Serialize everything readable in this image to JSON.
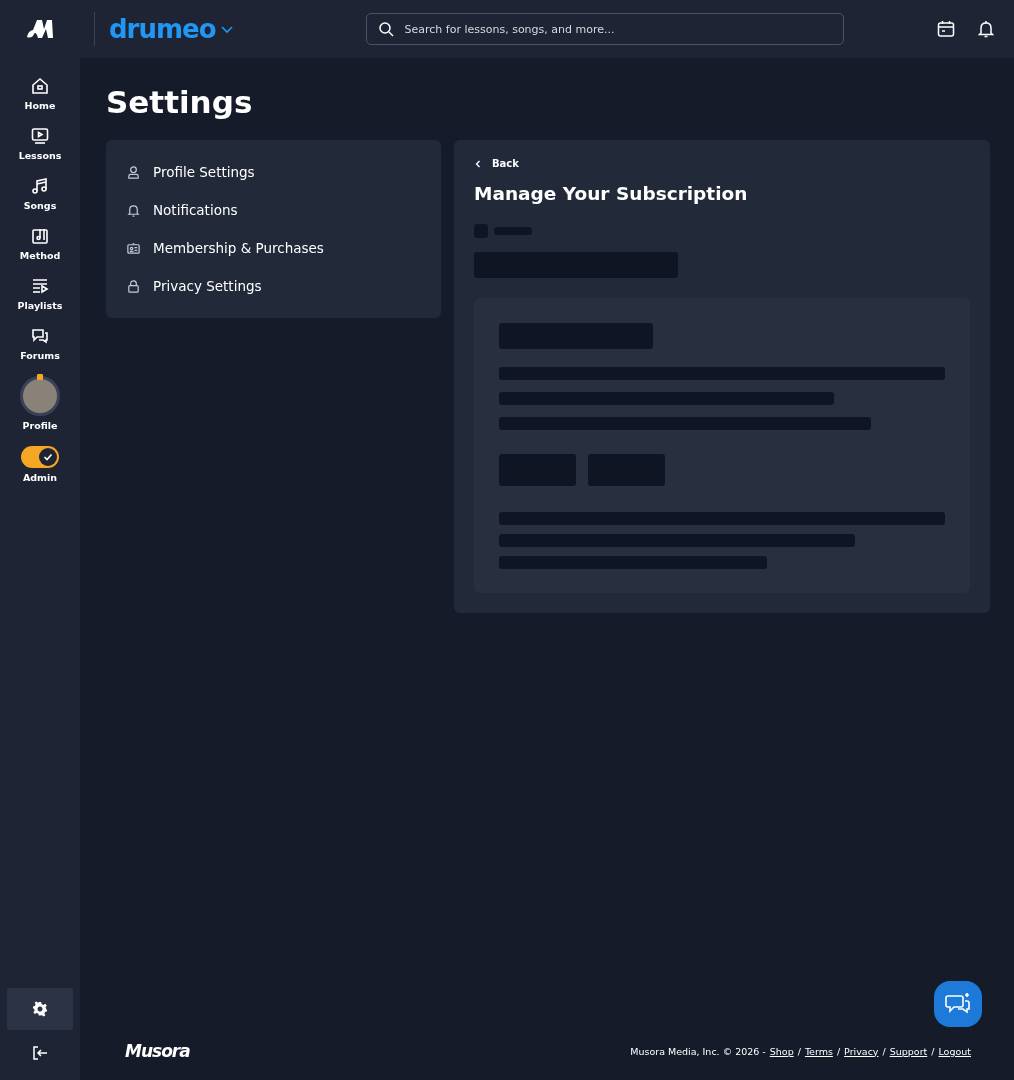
{
  "topbar": {
    "brand": "drumeo",
    "search": {
      "placeholder": "Search for lessons, songs, and more..."
    }
  },
  "sidebar": {
    "items": [
      {
        "kind": "home",
        "label": "Home"
      },
      {
        "kind": "lessons",
        "label": "Lessons"
      },
      {
        "kind": "songs",
        "label": "Songs"
      },
      {
        "kind": "method",
        "label": "Method"
      },
      {
        "kind": "playlists",
        "label": "Playlists"
      },
      {
        "kind": "forums",
        "label": "Forums"
      },
      {
        "kind": "profile",
        "label": "Profile"
      },
      {
        "kind": "toggle",
        "label": "Admin",
        "on": true
      }
    ],
    "settings_selected": true
  },
  "page": {
    "title": "Settings"
  },
  "settings_menu": [
    {
      "kind": "person",
      "label": "Profile Settings"
    },
    {
      "kind": "bell",
      "label": "Notifications"
    },
    {
      "kind": "card",
      "label": "Membership & Purchases"
    },
    {
      "kind": "lock",
      "label": "Privacy Settings"
    }
  ],
  "panel": {
    "back": "Back",
    "title": "Manage Your Subscription"
  },
  "footer": {
    "wordmark": "Musora",
    "copyright": "Musora Media, Inc. © 2026 -",
    "links": [
      {
        "label": "Shop"
      },
      {
        "separator": "/",
        "label": "Terms"
      },
      {
        "separator": "/",
        "label": "Privacy"
      },
      {
        "separator": "/",
        "label": "Support"
      },
      {
        "separator": "/",
        "label": "Logout"
      }
    ]
  }
}
